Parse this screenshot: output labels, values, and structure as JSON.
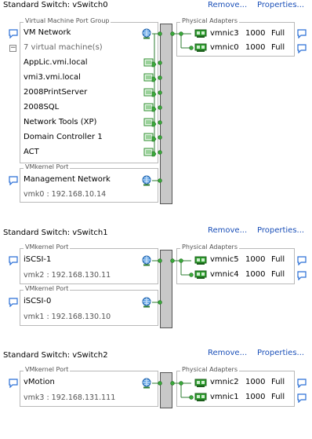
{
  "switches": [
    {
      "title": "Standard Switch: vSwitch0",
      "remove_label": "Remove...",
      "properties_label": "Properties...",
      "portgroups": [
        {
          "legend": "Virtual Machine Port Group",
          "name": "VM Network",
          "vm_count_label": "7 virtual machine(s)",
          "vms": [
            "AppLic.vmi.local",
            "vmi3.vmi.local",
            "2008PrintServer",
            "2008SQL",
            "Network Tools (XP)",
            "Domain Controller 1",
            "ACT"
          ]
        },
        {
          "legend": "VMkernel Port",
          "name": "Management Network",
          "detail": "vmk0 : 192.168.10.14"
        }
      ],
      "adapters_legend": "Physical Adapters",
      "adapters": [
        {
          "name": "vmnic3",
          "speed": "1000",
          "duplex": "Full"
        },
        {
          "name": "vmnic0",
          "speed": "1000",
          "duplex": "Full"
        }
      ]
    },
    {
      "title": "Standard Switch: vSwitch1",
      "remove_label": "Remove...",
      "properties_label": "Properties...",
      "portgroups": [
        {
          "legend": "VMkernel Port",
          "name": "iSCSI-1",
          "detail": "vmk2 : 192.168.130.11"
        },
        {
          "legend": "VMkernel Port",
          "name": "iSCSI-0",
          "detail": "vmk1 : 192.168.130.10"
        }
      ],
      "adapters_legend": "Physical Adapters",
      "adapters": [
        {
          "name": "vmnic5",
          "speed": "1000",
          "duplex": "Full"
        },
        {
          "name": "vmnic4",
          "speed": "1000",
          "duplex": "Full"
        }
      ]
    },
    {
      "title": "Standard Switch: vSwitch2",
      "remove_label": "Remove...",
      "properties_label": "Properties...",
      "portgroups": [
        {
          "legend": "VMkernel Port",
          "name": "vMotion",
          "detail": "vmk3 : 192.168.131.111"
        }
      ],
      "adapters_legend": "Physical Adapters",
      "adapters": [
        {
          "name": "vmnic2",
          "speed": "1000",
          "duplex": "Full"
        },
        {
          "name": "vmnic1",
          "speed": "1000",
          "duplex": "Full"
        }
      ]
    }
  ],
  "colors": {
    "link": "#1a4fb8",
    "wire": "#2e7d32",
    "switch_bar": "#c8c8c8",
    "nic_green": "#2f9e2f"
  },
  "icons": {
    "portgroup": "speech-bubble-icon",
    "network": "globe-network-icon",
    "vm": "virtual-machine-icon",
    "nic": "network-adapter-icon"
  }
}
